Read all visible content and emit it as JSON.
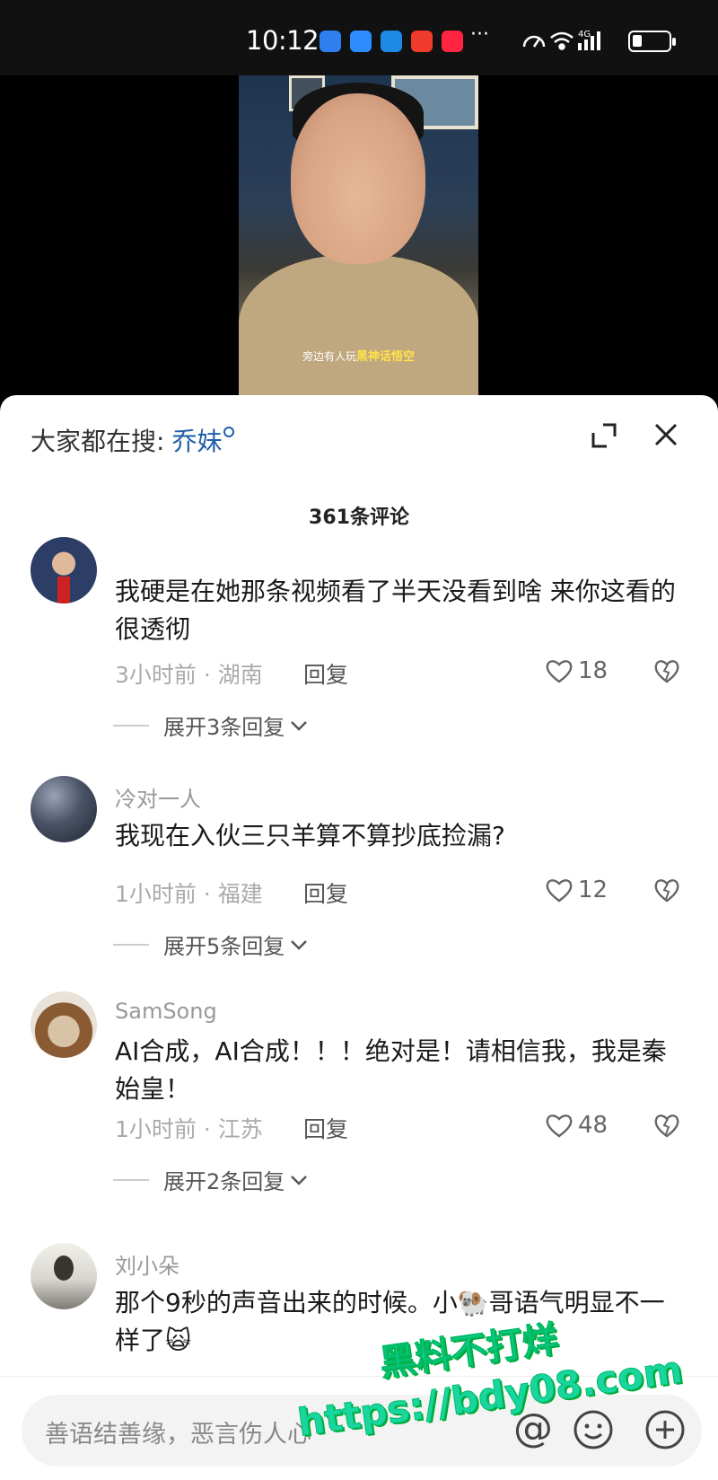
{
  "status_bar": {
    "time": "10:12",
    "more": "···",
    "network_label": "4G",
    "app_icons": [
      "blue-app-icon",
      "chat-bubble-icon",
      "blue-cube-icon",
      "red-shopping-icon",
      "red-xiaohongshu-icon"
    ]
  },
  "video": {
    "caption_prefix": "旁边有人玩",
    "caption_highlight": "黑神话悟空"
  },
  "header": {
    "search_prefix": "大家都在搜:",
    "search_keyword": "乔妹",
    "comment_count": "361条评论"
  },
  "comments": [
    {
      "username": "",
      "text": "我硬是在她那条视频看了半天没看到啥 来你这看的很透彻",
      "meta": "3小时前 · 湖南",
      "reply_label": "回复",
      "likes": "18",
      "expand_label": "展开3条回复"
    },
    {
      "username": "冷对一人",
      "text": "我现在入伙三只羊算不算抄底捡漏?",
      "meta": "1小时前 · 福建",
      "reply_label": "回复",
      "likes": "12",
      "expand_label": "展开5条回复"
    },
    {
      "username": "SamSong",
      "text": "AI合成，AI合成！！！绝对是！请相信我，我是秦始皇！",
      "meta": "1小时前 · 江苏",
      "reply_label": "回复",
      "likes": "48",
      "expand_label": "展开2条回复"
    },
    {
      "username": "刘小朵",
      "text": "那个9秒的声音出来的时候。小🐏哥语气明显不一样了🙀",
      "meta": "",
      "reply_label": "",
      "likes": "",
      "expand_label": ""
    }
  ],
  "input": {
    "placeholder": "善语结善缘，恶言伤人心",
    "at_symbol": "@"
  },
  "watermark": {
    "line1": "黑料不打烊",
    "line2": "https://bdy08.com"
  },
  "colors": {
    "accent_link": "#1f5fa8",
    "watermark": "#19d6a0",
    "caption_highlight": "#ffe24a"
  }
}
